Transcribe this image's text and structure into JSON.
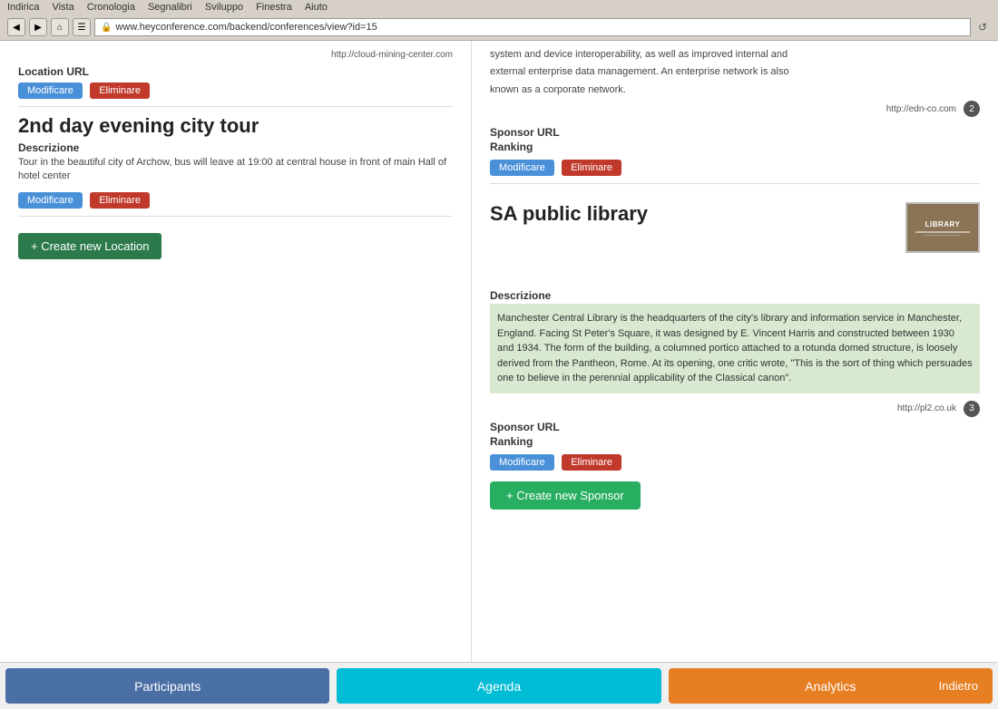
{
  "browser": {
    "menu_items": [
      "Indirica",
      "Vista",
      "Cronologia",
      "Segnalibri",
      "Sviluppo",
      "Finestra",
      "Aiuto"
    ],
    "url": "www.heyconference.com/backend/conferences/view?id=15",
    "reload_icon": "↺"
  },
  "left_panel": {
    "location_url_label": "Location URL",
    "url_above": "http://cloud-mining-center.com",
    "btn_modify_1": "Modificare",
    "btn_delete_1": "Eliminare",
    "section_title": "2nd day evening city tour",
    "description_label": "Descrizione",
    "description_text": "Tour in the beautiful city of Archow, bus will leave at 19:00 at central house in front of main Hall of hotel center",
    "btn_modify_2": "Modificare",
    "btn_delete_2": "Eliminare",
    "create_location_btn": "+ Create new Location"
  },
  "right_panel": {
    "top_text_1": "system and device interoperability, as well as improved internal and",
    "top_text_2": "external enterprise data management. An enterprise network is also",
    "top_text_3": "known as a corporate network.",
    "url_badge_1": {
      "url": "http://edn-co.com",
      "number": "2"
    },
    "sponsor_url_label_1": "Sponsor URL",
    "ranking_label_1": "Ranking",
    "btn_modify_s1": "Modificare",
    "btn_delete_s1": "Eliminare",
    "sponsor_title": "SA public library",
    "description_label": "Descrizione",
    "description_text": "Manchester Central Library is the headquarters of the city's library and information service in Manchester, England. Facing St Peter's Square, it was designed by E. Vincent Harris and constructed between 1930 and 1934. The form of the building, a columned portico attached to a rotunda domed structure, is loosely derived from the Pantheon, Rome. At its opening, one critic wrote, \"This is the sort of thing which persuades one to believe in the perennial applicability of the Classical canon\".",
    "library_label": "LIBRARY",
    "url_badge_2": {
      "url": "http://pl2.co.uk",
      "number": "3"
    },
    "sponsor_url_label_2": "Sponsor URL",
    "ranking_label_2": "Ranking",
    "btn_modify_s2": "Modificare",
    "btn_delete_s2": "Eliminare",
    "create_sponsor_btn": "+ Create new Sponsor"
  },
  "bottom_nav": {
    "participants": "Participants",
    "agenda": "Agenda",
    "analytics": "Analytics",
    "back": "Indietro"
  }
}
